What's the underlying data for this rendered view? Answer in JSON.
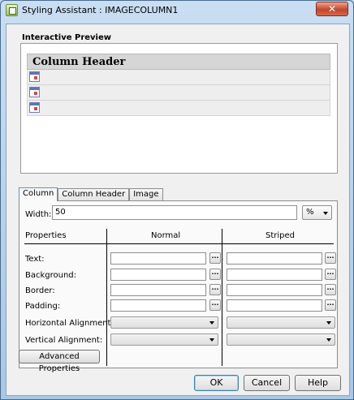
{
  "window": {
    "title": "Styling Assistant : IMAGECOLUMN1",
    "close_glyph": "✕"
  },
  "preview": {
    "group_label": "Interactive Preview",
    "column_header": "Column Header",
    "row_count": 3,
    "row_icon": "image-icon"
  },
  "tabs": [
    {
      "label": "Column",
      "active": true
    },
    {
      "label": "Column Header",
      "active": false
    },
    {
      "label": "Image",
      "active": false
    }
  ],
  "width": {
    "label": "Width:",
    "value": "50",
    "unit": "%"
  },
  "grid": {
    "col_properties": "Properties",
    "col_normal": "Normal",
    "col_striped": "Striped",
    "rows": [
      {
        "label": "Text:",
        "kind": "text"
      },
      {
        "label": "Background:",
        "kind": "text"
      },
      {
        "label": "Border:",
        "kind": "text"
      },
      {
        "label": "Padding:",
        "kind": "text"
      },
      {
        "label": "Horizontal Alignment:",
        "kind": "select"
      },
      {
        "label": "Vertical Alignment:",
        "kind": "select"
      }
    ],
    "ellipsis": "..."
  },
  "buttons": {
    "advanced": "Advanced Properties",
    "ok": "OK",
    "cancel": "Cancel",
    "help": "Help"
  }
}
